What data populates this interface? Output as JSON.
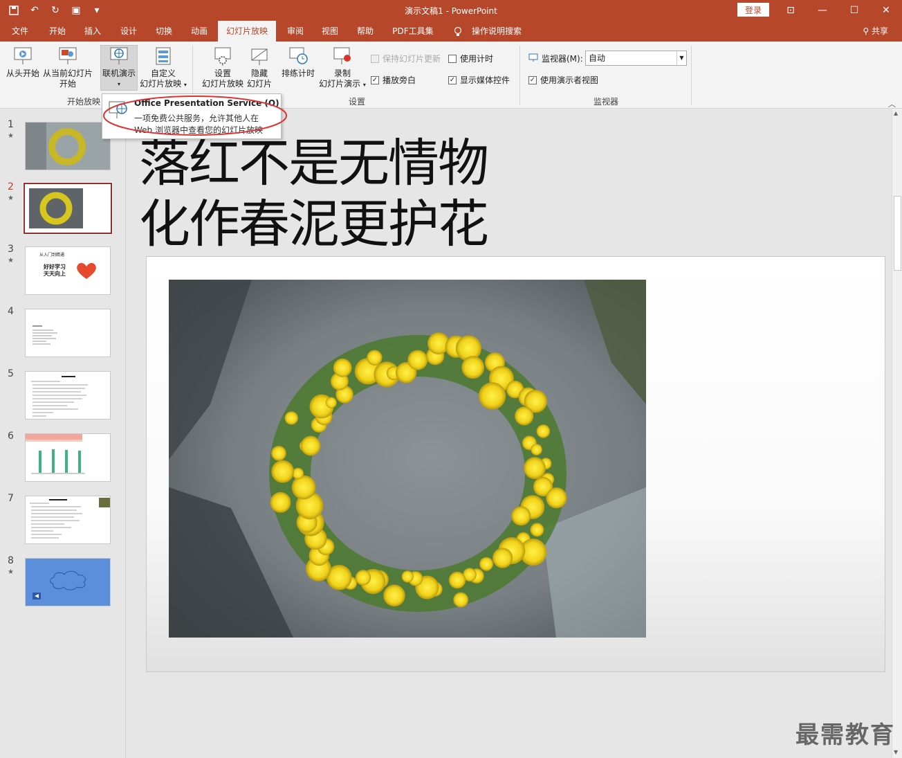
{
  "window": {
    "title": "演示文稿1  -  PowerPoint",
    "login": "登录"
  },
  "tabs": [
    "文件",
    "开始",
    "插入",
    "设计",
    "切换",
    "动画",
    "幻灯片放映",
    "审阅",
    "视图",
    "帮助",
    "PDF工具集",
    "操作说明搜索"
  ],
  "active_tab": "幻灯片放映",
  "share": "共享",
  "ribbon": {
    "start_group": {
      "label": "开始放映",
      "from_beginning": "从头开始",
      "from_current_1": "从当前幻灯片",
      "from_current_2": "开始",
      "online_present": "联机演示",
      "custom_1": "自定义",
      "custom_2": "幻灯片放映"
    },
    "setup_group": {
      "label": "设置",
      "setup_1": "设置",
      "setup_2": "幻灯片放映",
      "hide_1": "隐藏",
      "hide_2": "幻灯片",
      "rehearse": "排练计时",
      "record_1": "录制",
      "record_2": "幻灯片演示",
      "keep_updated": "保持幻灯片更新",
      "use_timings": "使用计时",
      "play_narration": "播放旁白",
      "show_media_controls": "显示媒体控件"
    },
    "monitor_group": {
      "label": "监视器",
      "monitor_label": "监视器(M):",
      "monitor_value": "自动",
      "presenter_view": "使用演示者视图"
    }
  },
  "tooltip": {
    "title": "Office Presentation Service (O)",
    "desc_1": "一项免费公共服务，允许其他人在",
    "desc_2": "Web 浏览器中查看您的幻灯片放映"
  },
  "thumbnails": [
    {
      "num": "1",
      "star": "★"
    },
    {
      "num": "2",
      "star": "★"
    },
    {
      "num": "3",
      "star": "★",
      "title": "从入门到精通",
      "text_1": "好好学习",
      "text_2": "天天向上"
    },
    {
      "num": "4",
      "star": ""
    },
    {
      "num": "5",
      "star": ""
    },
    {
      "num": "6",
      "star": ""
    },
    {
      "num": "7",
      "star": ""
    },
    {
      "num": "8",
      "star": "★"
    }
  ],
  "slide": {
    "title_line_1": "落红不是无情物",
    "title_line_2": "化作春泥更护花"
  },
  "watermark": "最需教育",
  "colors": {
    "accent": "#b7472a",
    "selected_thumb": "#9b2a2a",
    "annotation_ring": "#e03030"
  }
}
